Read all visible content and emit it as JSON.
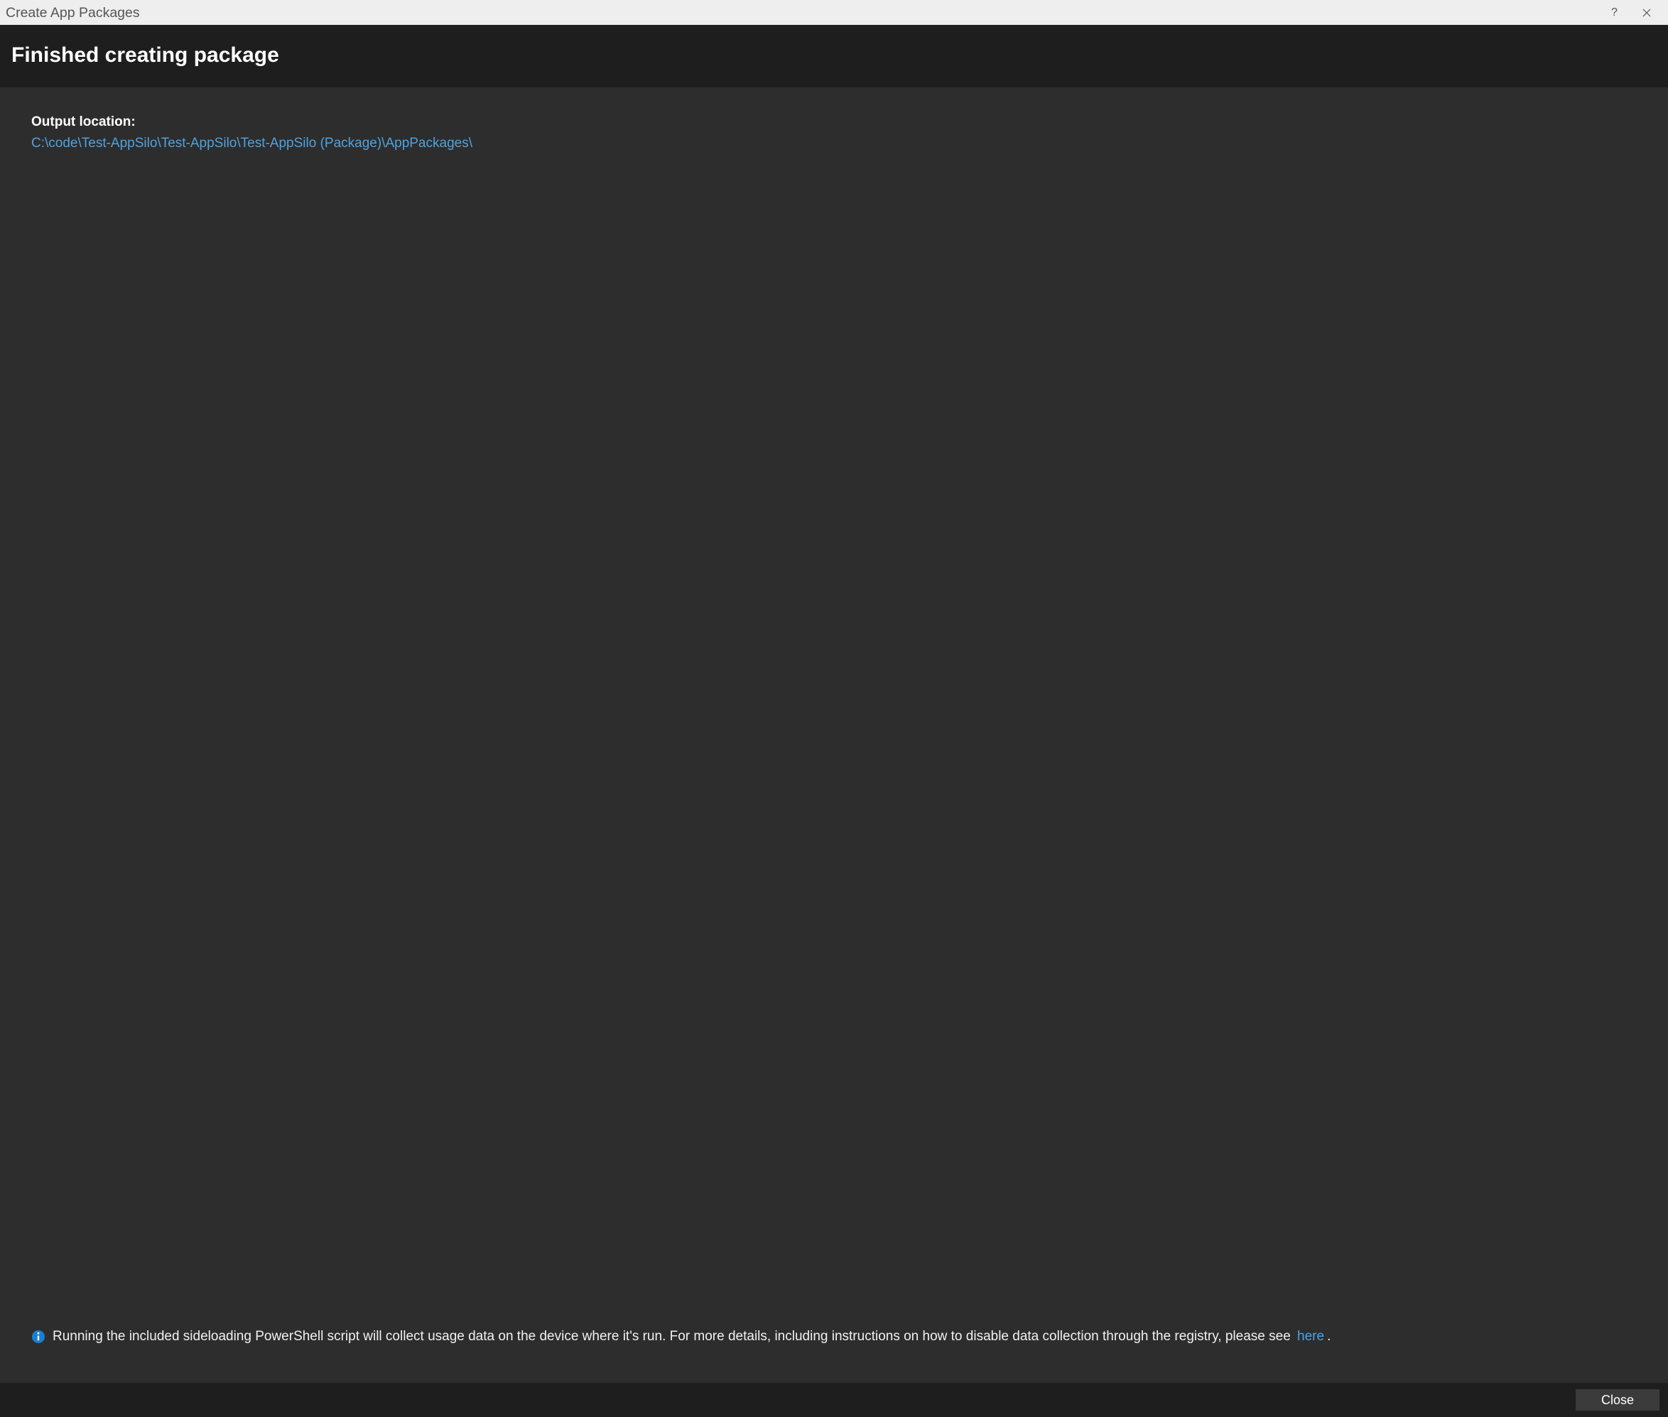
{
  "titlebar": {
    "title": "Create App Packages",
    "help_symbol": "?"
  },
  "header": {
    "heading": "Finished creating package"
  },
  "content": {
    "output_label": "Output location:",
    "output_path": "C:\\code\\Test-AppSilo\\Test-AppSilo\\Test-AppSilo (Package)\\AppPackages\\"
  },
  "info": {
    "text_before": "Running the included sideloading PowerShell script will collect usage data on the device where it's run.  For more details, including instructions on how to disable data collection through the registry, please see ",
    "link_text": "here",
    "text_after": "."
  },
  "footer": {
    "close_label": "Close"
  }
}
